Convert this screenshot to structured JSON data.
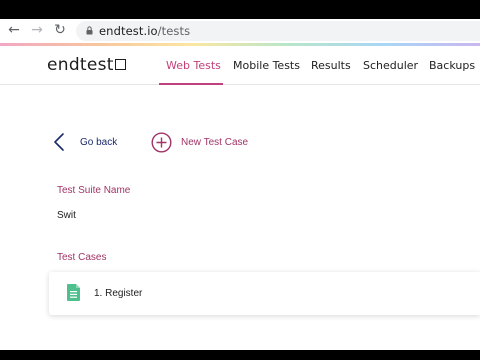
{
  "browser": {
    "url_host": "endtest.io",
    "url_path": "/tests",
    "back_icon": "arrow-left-icon",
    "forward_icon": "arrow-right-icon",
    "reload_icon": "reload-icon",
    "lock_icon": "lock-icon"
  },
  "app": {
    "logo_text": "endtest",
    "logo_mark": "checkbox-icon",
    "nav": {
      "tabs": [
        {
          "label": "Web Tests",
          "active": true
        },
        {
          "label": "Mobile Tests",
          "active": false
        },
        {
          "label": "Results",
          "active": false
        },
        {
          "label": "Scheduler",
          "active": false
        },
        {
          "label": "Backups",
          "active": false
        }
      ]
    },
    "actions": {
      "back_label": "Go back",
      "new_test_case_label": "New Test Case"
    },
    "suite": {
      "name_label": "Test Suite Name",
      "name_value": "Swit"
    },
    "cases": {
      "label": "Test Cases",
      "items": [
        {
          "label": "1. Register",
          "icon": "document-icon"
        }
      ]
    }
  },
  "colors": {
    "accent": "#c2417a",
    "label_accent": "#a13366",
    "back_link": "#1b2a6b",
    "doc_icon": "#4fc08d"
  }
}
